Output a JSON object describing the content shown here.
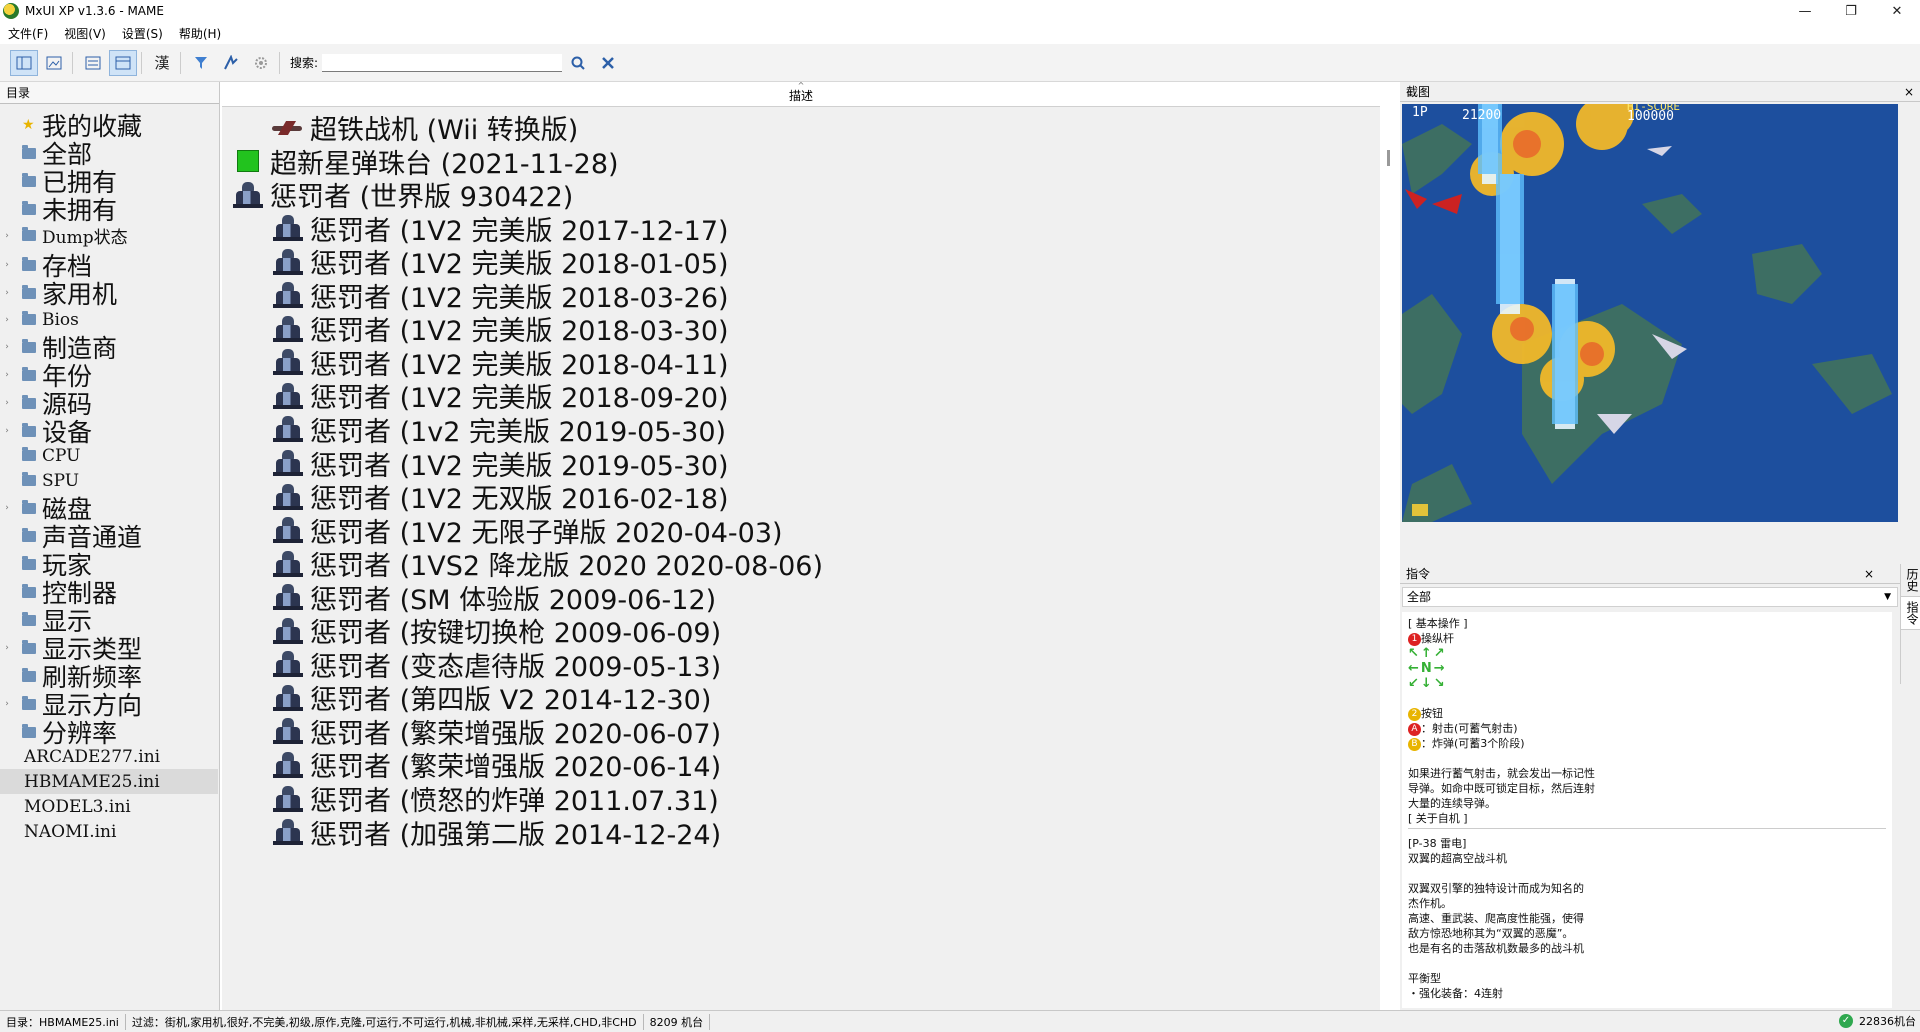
{
  "window": {
    "title": "MxUI XP v1.3.6 - MAME",
    "minimize": "—",
    "maximize": "❐",
    "close": "✕"
  },
  "menubar": [
    "文件(F)",
    "视图(V)",
    "设置(S)",
    "帮助(H)"
  ],
  "toolbar": {
    "search_label": "搜索:",
    "search_value": "",
    "han_glyph": "漢"
  },
  "left_panel": {
    "header": "目录",
    "items": [
      {
        "label": "我的收藏",
        "kind": "star",
        "size": "big",
        "expand": false
      },
      {
        "label": "全部",
        "kind": "folder",
        "size": "big",
        "expand": false
      },
      {
        "label": "已拥有",
        "kind": "folder",
        "size": "big",
        "expand": false
      },
      {
        "label": "未拥有",
        "kind": "folder",
        "size": "big",
        "expand": false
      },
      {
        "label": "Dump状态",
        "kind": "folder",
        "size": "small",
        "expand": true
      },
      {
        "label": "存档",
        "kind": "folder",
        "size": "big",
        "expand": true
      },
      {
        "label": "家用机",
        "kind": "folder",
        "size": "big",
        "expand": true
      },
      {
        "label": "Bios",
        "kind": "folder",
        "size": "small",
        "expand": true
      },
      {
        "label": "制造商",
        "kind": "folder",
        "size": "big",
        "expand": true
      },
      {
        "label": "年份",
        "kind": "folder",
        "size": "big",
        "expand": true
      },
      {
        "label": "源码",
        "kind": "folder",
        "size": "big",
        "expand": true
      },
      {
        "label": "设备",
        "kind": "folder",
        "size": "big",
        "expand": true
      },
      {
        "label": "CPU",
        "kind": "folder",
        "size": "small",
        "expand": false
      },
      {
        "label": "SPU",
        "kind": "folder",
        "size": "small",
        "expand": false
      },
      {
        "label": "磁盘",
        "kind": "folder",
        "size": "big",
        "expand": true
      },
      {
        "label": "声音通道",
        "kind": "folder",
        "size": "big",
        "expand": false
      },
      {
        "label": "玩家",
        "kind": "folder",
        "size": "big",
        "expand": false
      },
      {
        "label": "控制器",
        "kind": "folder",
        "size": "big",
        "expand": false
      },
      {
        "label": "显示",
        "kind": "folder",
        "size": "big",
        "expand": false
      },
      {
        "label": "显示类型",
        "kind": "folder",
        "size": "big",
        "expand": true
      },
      {
        "label": "刷新频率",
        "kind": "folder",
        "size": "big",
        "expand": false
      },
      {
        "label": "显示方向",
        "kind": "folder",
        "size": "big",
        "expand": true
      },
      {
        "label": "分辨率",
        "kind": "folder",
        "size": "big",
        "expand": false
      },
      {
        "label": "ARCADE277.ini",
        "kind": "ini",
        "size": "small",
        "expand": false
      },
      {
        "label": "HBMAME25.ini",
        "kind": "ini",
        "size": "small",
        "expand": false,
        "selected": true
      },
      {
        "label": "MODEL3.ini",
        "kind": "ini",
        "size": "small",
        "expand": false
      },
      {
        "label": "NAOMI.ini",
        "kind": "ini",
        "size": "small",
        "expand": false
      }
    ]
  },
  "center_panel": {
    "header": "描述",
    "games": [
      {
        "name": "超铁战机 (Wii 转换版)",
        "icon": "jet",
        "indent": true
      },
      {
        "name": "超新星弹珠台 (2021-11-28)",
        "icon": "green",
        "indent": false
      },
      {
        "name": "惩罚者 (世界版 930422)",
        "icon": "sprite",
        "indent": false
      },
      {
        "name": "惩罚者 (1V2 完美版 2017-12-17)",
        "icon": "sprite",
        "indent": true
      },
      {
        "name": "惩罚者 (1V2 完美版 2018-01-05)",
        "icon": "sprite",
        "indent": true
      },
      {
        "name": "惩罚者 (1V2 完美版 2018-03-26)",
        "icon": "sprite",
        "indent": true
      },
      {
        "name": "惩罚者 (1V2 完美版 2018-03-30)",
        "icon": "sprite",
        "indent": true
      },
      {
        "name": "惩罚者 (1V2 完美版 2018-04-11)",
        "icon": "sprite",
        "indent": true
      },
      {
        "name": "惩罚者 (1V2 完美版 2018-09-20)",
        "icon": "sprite",
        "indent": true
      },
      {
        "name": "惩罚者 (1v2 完美版 2019-05-30)",
        "icon": "sprite",
        "indent": true
      },
      {
        "name": "惩罚者 (1V2 完美版 2019-05-30)",
        "icon": "sprite",
        "indent": true
      },
      {
        "name": "惩罚者 (1V2 无双版 2016-02-18)",
        "icon": "sprite",
        "indent": true
      },
      {
        "name": "惩罚者 (1V2 无限子弹版 2020-04-03)",
        "icon": "sprite",
        "indent": true
      },
      {
        "name": "惩罚者 (1VS2 降龙版 2020 2020-08-06)",
        "icon": "sprite",
        "indent": true
      },
      {
        "name": "惩罚者 (SM 体验版 2009-06-12)",
        "icon": "sprite",
        "indent": true
      },
      {
        "name": "惩罚者 (按键切换枪 2009-06-09)",
        "icon": "sprite",
        "indent": true
      },
      {
        "name": "惩罚者 (变态虐待版 2009-05-13)",
        "icon": "sprite",
        "indent": true
      },
      {
        "name": "惩罚者 (第四版 V2 2014-12-30)",
        "icon": "sprite",
        "indent": true
      },
      {
        "name": "惩罚者 (繁荣增强版 2020-06-07)",
        "icon": "sprite",
        "indent": true
      },
      {
        "name": "惩罚者 (繁荣增强版 2020-06-14)",
        "icon": "sprite",
        "indent": true
      },
      {
        "name": "惩罚者 (愤怒的炸弹 2011.07.31)",
        "icon": "sprite",
        "indent": true
      },
      {
        "name": "惩罚者 (加强第二版 2014-12-24)",
        "icon": "sprite",
        "indent": true
      }
    ]
  },
  "right_panel": {
    "screenshot_header": "截图",
    "close": "×",
    "hud_p1": "1P",
    "hud_score": "21200",
    "hud_hiscore_label": "HI-SCORE",
    "hud_hiscore": "100000",
    "command_header": "指令",
    "command_select": "全部",
    "side_tabs": [
      "历史",
      "指令"
    ],
    "cmd": {
      "basic": "[ 基本操作 ]",
      "num1": "1",
      "stick": "操纵杆",
      "arrows1": "↖↑↗",
      "arrows2": "←N→",
      "arrows3": "↙↓↘",
      "num2": "2",
      "buttons": "按钮",
      "btnA": "A",
      "btnA_desc": "：射击(可蓄气射击)",
      "btnB": "B",
      "btnB_desc": "：炸弹(可蓄3个阶段)",
      "para1": "如果进行蓄气射击，就会发出一标记性\n导弹。如命中既可锁定目标，然后连射\n大量的连续导弹。",
      "about": "[ 关于自机 ]",
      "plane_title": "[P-38 雷电]",
      "plane_sub": "双翼的超高空战斗机",
      "para2": "双翼双引擎的独特设计而成为知名的\n杰作机。\n高速、重武装、爬高度性能强，使得\n敌方惊恐地称其为“双翼的恶魔”。\n也是有名的击落敌机数最多的战斗机",
      "balance": "平衡型",
      "last": "・强化装备：4连射"
    }
  },
  "statusbar": {
    "segments": [
      "目录：HBMAME25.ini",
      "过滤：街机,家用机,很好,不完美,初级,原作,克隆,可运行,不可运行,机械,非机械,采样,无采样,CHD,非CHD",
      "8209 机台"
    ],
    "right": "22836机台",
    "ok_icon": "✓"
  }
}
